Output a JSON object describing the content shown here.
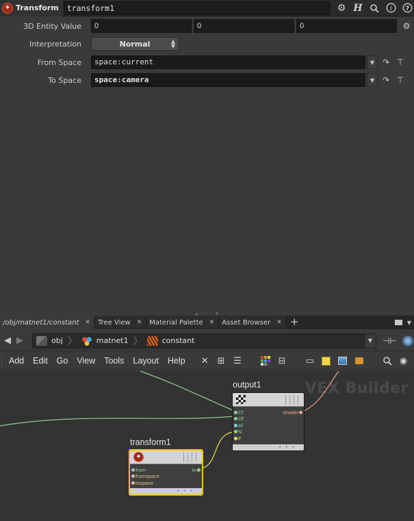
{
  "param_header": {
    "node_type": "Transform",
    "node_name": "transform1",
    "icons": [
      "gear-icon",
      "help-h-icon",
      "search-icon",
      "info-icon",
      "help-icon"
    ]
  },
  "params": {
    "entity_value": {
      "label": "3D Entity Value",
      "values": [
        "0",
        "0",
        "0"
      ]
    },
    "interpretation": {
      "label": "Interpretation",
      "value": "Normal"
    },
    "from_space": {
      "label": "From Space",
      "value": "space:current"
    },
    "to_space": {
      "label": "To Space",
      "value": "space:camera"
    }
  },
  "tabs": [
    {
      "label": "/obj/matnet1/constant",
      "active": true
    },
    {
      "label": "Tree View",
      "active": false
    },
    {
      "label": "Material Palette",
      "active": false
    },
    {
      "label": "Asset Browser",
      "active": false
    }
  ],
  "tab_add": "+",
  "path": {
    "crumbs": [
      "obj",
      "matnet1",
      "constant"
    ]
  },
  "menu": {
    "items": [
      "Add",
      "Edit",
      "Go",
      "View",
      "Tools",
      "Layout",
      "Help"
    ]
  },
  "network": {
    "watermark": "VEX Builder",
    "output_node": {
      "name": "output1",
      "inputs": [
        "Cf",
        "Of",
        "Af",
        "N",
        "F"
      ],
      "output": "shader"
    },
    "transform_node": {
      "name": "transform1",
      "inputs": [
        "from",
        "fromspace",
        "tospace"
      ],
      "output": "to"
    }
  },
  "colors": {
    "wire_green": "#8fd08f",
    "wire_yellow": "#e6e25a",
    "wire_shader": "#e6a98a",
    "selected_outline": "#f2c200"
  }
}
